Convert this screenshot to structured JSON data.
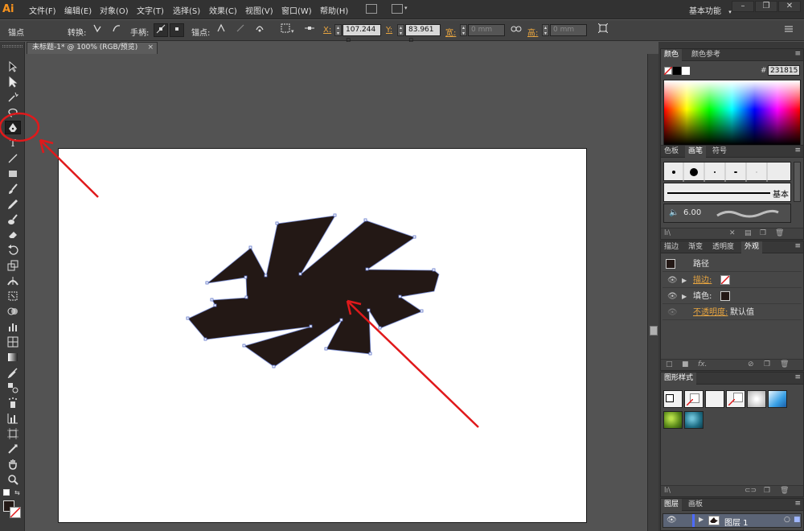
{
  "app": {
    "logo": "Ai"
  },
  "menu": [
    "文件(F)",
    "编辑(E)",
    "对象(O)",
    "文字(T)",
    "选择(S)",
    "效果(C)",
    "视图(V)",
    "窗口(W)",
    "帮助(H)"
  ],
  "workspace": {
    "label": "基本功能",
    "arrow": "▾"
  },
  "window_buttons": [
    "–",
    "❐",
    "✕"
  ],
  "control": {
    "selection_label": "锚点",
    "convert_label": "转换:",
    "handles_label": "手柄:",
    "anchors_label": "锚点:",
    "x_label": "X:",
    "x_value": "107.244 ▫",
    "y_label": "Y:",
    "y_value": "83.961 ▫",
    "w_label": "宽:",
    "w_value": "0 mm",
    "h_label": "高:",
    "h_value": "0 mm"
  },
  "document": {
    "tab": "未标题-1* @ 100% (RGB/预览)",
    "close": "×"
  },
  "color_panel": {
    "tabs": [
      "颜色",
      "颜色参考"
    ],
    "hash": "#",
    "hex": "231815"
  },
  "brush_panel": {
    "tabs": [
      "色板",
      "画笔",
      "符号"
    ],
    "basic_label": "基本",
    "size": "6.00"
  },
  "appearance_panel": {
    "tabs": [
      "描边",
      "渐变",
      "透明度",
      "外观"
    ],
    "title": "路径",
    "stroke_label": "描边:",
    "fill_label": "填色:",
    "opacity_label": "不透明度:",
    "opacity_value": "默认值",
    "fx": "fx."
  },
  "graphic_styles_panel": {
    "tabs": [
      "图形样式"
    ]
  },
  "layers_panel": {
    "tabs": [
      "图层",
      "画板"
    ],
    "layer_name": "图层 1"
  },
  "colors": {
    "shape_fill": "#231815",
    "path_stroke": "#7b8fd6",
    "annotation": "#e0191b",
    "accent_orange": "#e8a540"
  }
}
